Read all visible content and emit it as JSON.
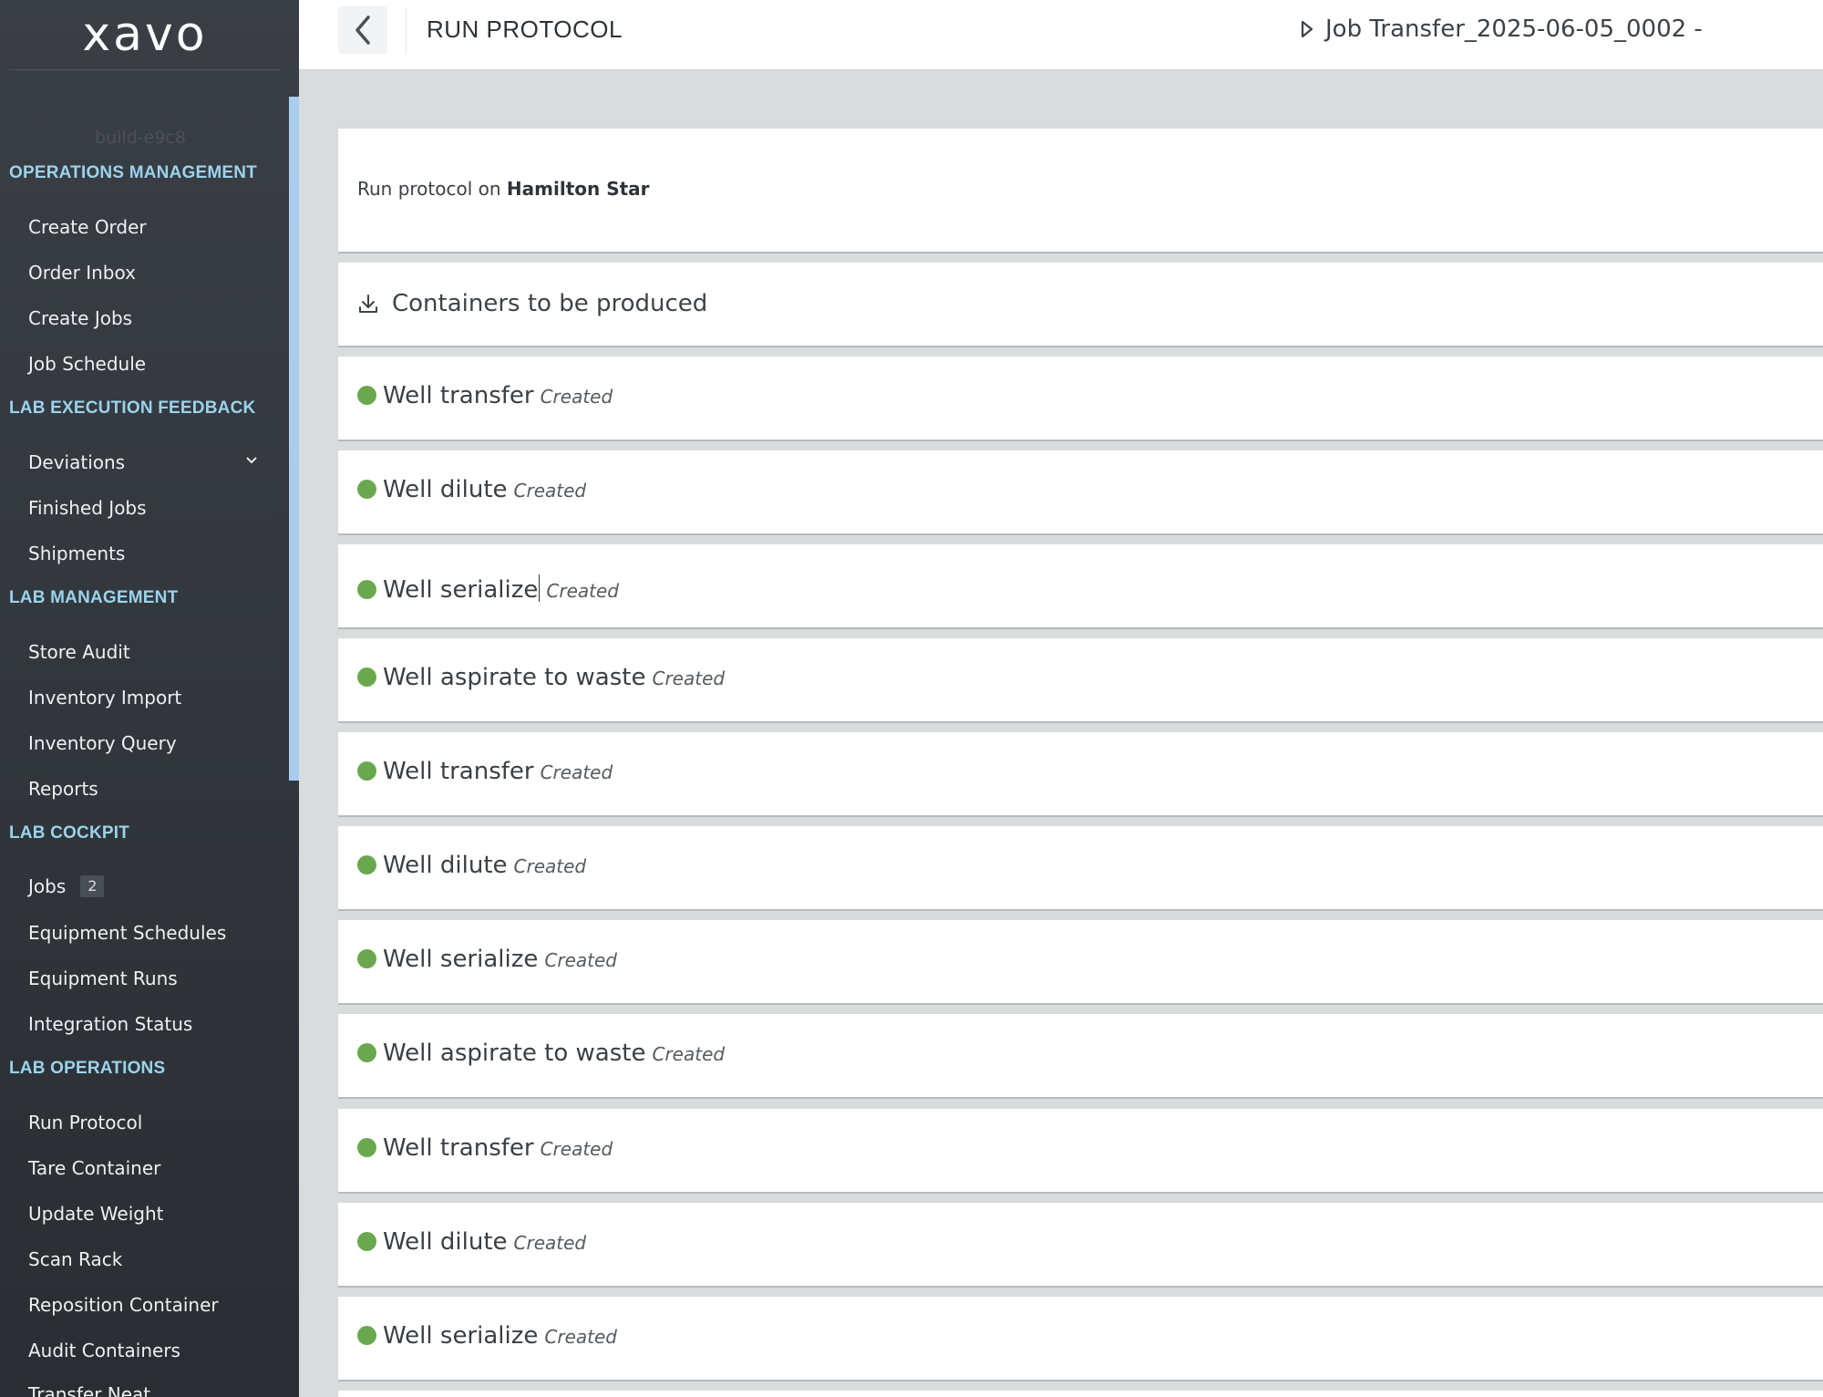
{
  "app": {
    "logo": "xavo",
    "build": "build-e9c8"
  },
  "sidebar": {
    "sections": [
      {
        "title": "OPERATIONS MANAGEMENT",
        "items": [
          "Create Order",
          "Order Inbox",
          "Create Jobs",
          "Job Schedule"
        ]
      },
      {
        "title": "LAB EXECUTION FEEDBACK",
        "items": [
          "Deviations",
          "Finished Jobs",
          "Shipments"
        ]
      },
      {
        "title": "LAB MANAGEMENT",
        "items": [
          "Store Audit",
          "Inventory Import",
          "Inventory Query",
          "Reports"
        ]
      },
      {
        "title": "LAB COCKPIT",
        "items": [
          "Jobs",
          "Equipment Schedules",
          "Equipment Runs",
          "Integration Status"
        ],
        "jobs_badge": "2"
      },
      {
        "title": "LAB OPERATIONS",
        "items": [
          "Run Protocol",
          "Tare Container",
          "Update Weight",
          "Scan Rack",
          "Reposition Container",
          "Audit Containers",
          "Transfer Neat"
        ]
      }
    ]
  },
  "header": {
    "title": "RUN PROTOCOL",
    "job": "Job Transfer_2025-06-05_0002 -"
  },
  "main": {
    "run_prefix": "Run protocol on",
    "equipment": "Hamilton Star",
    "containers_label": "Containers to be produced",
    "tasks": [
      {
        "name": "Well transfer",
        "status": "Created",
        "status_color": "#6aa84f"
      },
      {
        "name": "Well dilute",
        "status": "Created",
        "status_color": "#6aa84f"
      },
      {
        "name": "Well serialize",
        "status": "Created",
        "status_color": "#6aa84f"
      },
      {
        "name": "Well aspirate to waste",
        "status": "Created",
        "status_color": "#6aa84f"
      },
      {
        "name": "Well transfer",
        "status": "Created",
        "status_color": "#6aa84f"
      },
      {
        "name": "Well dilute",
        "status": "Created",
        "status_color": "#6aa84f"
      },
      {
        "name": "Well serialize",
        "status": "Created",
        "status_color": "#6aa84f"
      },
      {
        "name": "Well aspirate to waste",
        "status": "Created",
        "status_color": "#6aa84f"
      },
      {
        "name": "Well transfer",
        "status": "Created",
        "status_color": "#6aa84f"
      },
      {
        "name": "Well dilute",
        "status": "Created",
        "status_color": "#6aa84f"
      },
      {
        "name": "Well serialize",
        "status": "Created",
        "status_color": "#6aa84f"
      }
    ]
  }
}
